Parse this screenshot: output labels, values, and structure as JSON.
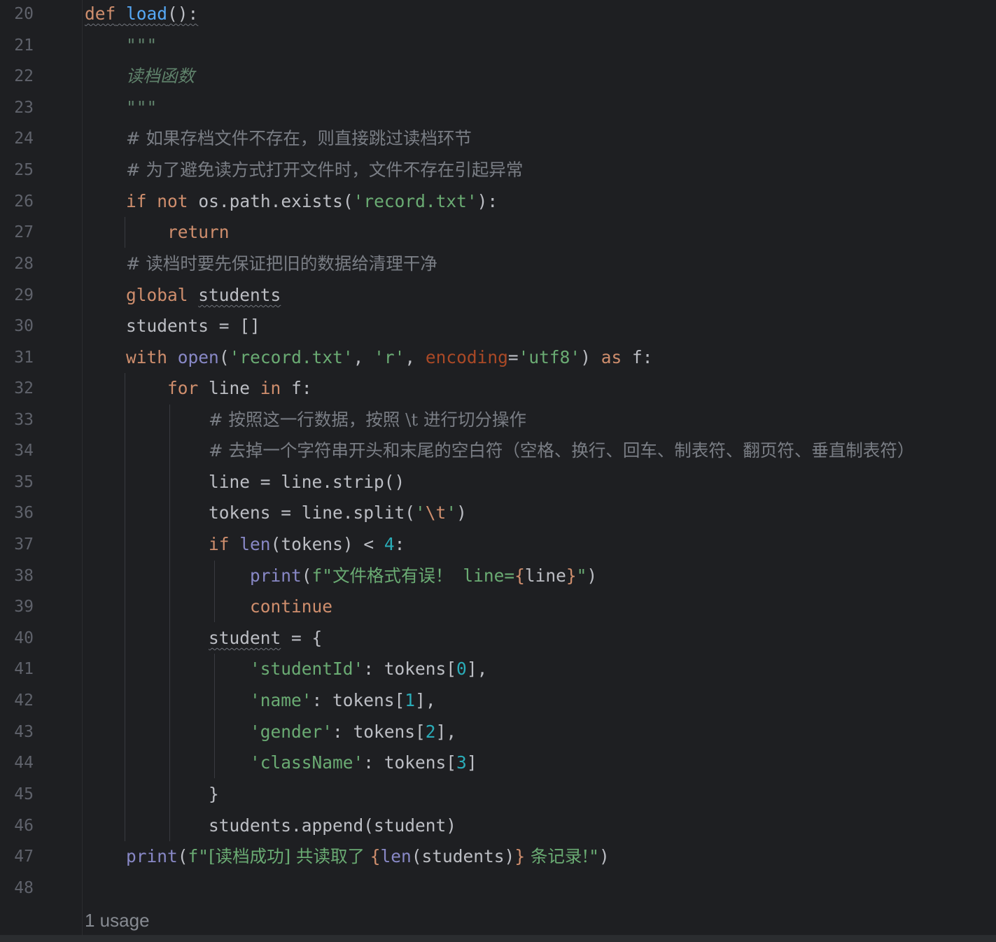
{
  "line_numbers": [
    "20",
    "21",
    "22",
    "23",
    "24",
    "25",
    "26",
    "27",
    "28",
    "29",
    "30",
    "31",
    "32",
    "33",
    "34",
    "35",
    "36",
    "37",
    "38",
    "39",
    "40",
    "41",
    "42",
    "43",
    "44",
    "45",
    "46",
    "47",
    "48"
  ],
  "code": {
    "l20": {
      "def": "def",
      "name": "load",
      "rest": "():"
    },
    "l21": {
      "doc": "\"\"\""
    },
    "l22": {
      "doc": "读档函数"
    },
    "l23": {
      "doc": "\"\"\""
    },
    "l24": {
      "comment": "# 如果存档文件不存在，则直接跳过读档环节"
    },
    "l25": {
      "comment": "# 为了避免读方式打开文件时，文件不存在引起异常"
    },
    "l26": {
      "if": "if",
      "not": "not",
      "mid": " os.path.exists(",
      "str": "'record.txt'",
      "end": "):"
    },
    "l27": {
      "return": "return"
    },
    "l28": {
      "comment": "# 读档时要先保证把旧的数据给清理干净"
    },
    "l29": {
      "global": "global",
      "var": "students"
    },
    "l30": {
      "text": "students = []"
    },
    "l31": {
      "with": "with",
      "open": "open",
      "p1": "(",
      "s1": "'record.txt'",
      "c1": ", ",
      "s2": "'r'",
      "c2": ", ",
      "param": "encoding",
      "eq": "=",
      "s3": "'utf8'",
      "p2": ")",
      "as": "as",
      "end": " f:"
    },
    "l32": {
      "for": "for",
      "mid": " line ",
      "in": "in",
      "end": " f:"
    },
    "l33": {
      "comment": "# 按照这一行数据，按照 \\t 进行切分操作"
    },
    "l34": {
      "comment": "# 去掉一个字符串开头和末尾的空白符（空格、换行、回车、制表符、翻页符、垂直制表符）"
    },
    "l35": {
      "text": "line = line.strip()"
    },
    "l36": {
      "pre": "tokens = line.split(",
      "q1": "'",
      "esc": "\\t",
      "q2": "'",
      "end": ")"
    },
    "l37": {
      "if": "if",
      "len": "len",
      "mid": "(tokens) < ",
      "num": "4",
      "end": ":"
    },
    "l38": {
      "print": "print",
      "p1": "(",
      "s1": "f\"",
      "cn": "文件格式有误！",
      "s2": " line=",
      "b1": "{",
      "var": "line",
      "b2": "}",
      "s3": "\"",
      "p2": ")"
    },
    "l39": {
      "continue": "continue"
    },
    "l40": {
      "var": "student",
      "rest": " = {"
    },
    "l41": {
      "key": "'studentId'",
      "mid": ": tokens[",
      "num": "0",
      "end": "],"
    },
    "l42": {
      "key": "'name'",
      "mid": ": tokens[",
      "num": "1",
      "end": "],"
    },
    "l43": {
      "key": "'gender'",
      "mid": ": tokens[",
      "num": "2",
      "end": "],"
    },
    "l44": {
      "key": "'className'",
      "mid": ": tokens[",
      "num": "3",
      "end": "]"
    },
    "l45": {
      "text": "}"
    },
    "l46": {
      "text": "students.append(student)"
    },
    "l47": {
      "print": "print",
      "p1": "(",
      "s1": "f\"",
      "cn1": "[读档成功] 共读取了 ",
      "b1": "{",
      "len": "len",
      "mid": "(students)",
      "b2": "}",
      "cn2": " 条记录!",
      "s2": "\"",
      "p2": ")"
    }
  },
  "usage_hint": "1 usage"
}
